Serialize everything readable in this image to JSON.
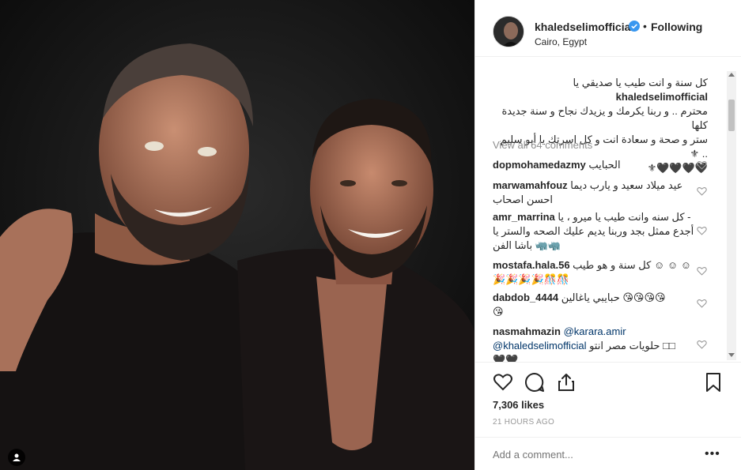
{
  "header": {
    "username": "khaledselimofficial",
    "dot": "•",
    "follow_status": "Following",
    "location": "Cairo, Egypt"
  },
  "caption": {
    "username": "khaledselimofficial",
    "text_line1": "كل سنة و انت طيب يا صديقي يا",
    "text_line2": "محترم .. و ربنا يكرمك و يزيدك نجاح و سنة جديدة كلها",
    "text_line3": "ستر و صحة و سعادة انت و كل اسرتك يا أبو سليم .. ⚜",
    "text_line4": "🖤🖤🖤🖤⚜"
  },
  "view_all": "View all 64 comments",
  "comments": [
    {
      "user": "dopmohamedazmy",
      "lines": [
        "الحبايب"
      ]
    },
    {
      "user": "marwamahfouz",
      "lines": [
        "عيد ميلاد سعيد و يارب ديما",
        "احسن اصحاب"
      ]
    },
    {
      "user": "amr_marrina",
      "lines": [
        "كل سنه وانت طيب يا ميرو ، يا -",
        "أجدع ممثل بجد وربنا يديم عليك الصحه والستر يا",
        "باشا الفن 🦏🦏"
      ]
    },
    {
      "user": "mostafa.hala.56",
      "lines": [
        "كل سنة و هو طيب ☺ ☺ ☺",
        "🎉🎉🎉🎉🎊🎊"
      ]
    },
    {
      "user": "dabdob_4444",
      "lines": [
        "حبايبي ياغالين 😘😘😘😘",
        "😘"
      ]
    },
    {
      "user": "nasmahmazin",
      "mention1": "@karara.amir",
      "mention2": "@khaledselimofficial",
      "lines": [
        "حلويات مصر انتو □□",
        "🖤🖤"
      ]
    }
  ],
  "likes": "7,306 likes",
  "time": "21 HOURS AGO",
  "add_comment_placeholder": "Add a comment...",
  "more_label": "•••",
  "icons": {
    "heart": "heart-icon",
    "comment": "comment-icon",
    "share": "share-icon",
    "bookmark": "bookmark-icon",
    "verified": "verified-badge-icon",
    "tag": "user-tag-icon"
  },
  "colors": {
    "verified_blue": "#3897f0",
    "muted": "#8e8e8e",
    "text": "#262626"
  }
}
